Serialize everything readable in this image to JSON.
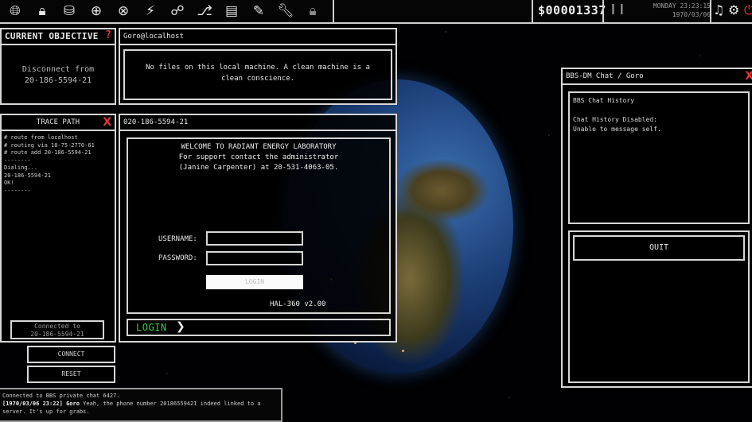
{
  "topbar": {
    "icons": [
      "globe-icon",
      "lock-globe-icon",
      "database-icon",
      "network-globe-icon",
      "linked-globe-icon",
      "satellite-icon",
      "broken-link-icon",
      "stamp-icon",
      "notebook-icon",
      "notepad-icon",
      "wrench-icon",
      "padlock-icon"
    ],
    "money": "$00001337",
    "pause_glyph": "❙❙",
    "clock_line1": "MONDAY 23:23:15",
    "clock_line2": "1970/03/06",
    "music_glyph": "♫",
    "gear_glyph": "⚙",
    "power_glyph": "⏻"
  },
  "objective": {
    "title": "CURRENT OBJECTIVE",
    "help": "?",
    "line1": "Disconnect from",
    "line2": "20-186-5594-21"
  },
  "local": {
    "title": "Goro@localhost",
    "message": "No files on this local machine. A clean machine is a clean conscience."
  },
  "trace": {
    "title": "TRACE PATH",
    "close": "X",
    "lines": "# route from localhost\n# routing via 18-75-2770-61\n# route add 20-186-5594-21\n--------\nDialing...\n20-186-5594-21\nOK!\n--------",
    "connected_line1": "Connected to",
    "connected_line2": "20-186-5594-21"
  },
  "actions": {
    "connect": "CONNECT",
    "reset": "RESET"
  },
  "remote": {
    "title": "020-186-5594-21",
    "welcome1": "WELCOME TO RADIANT ENERGY LABORATORY",
    "welcome2": "For support contact the administrator",
    "welcome3": "(Janine Carpenter) at 20-531-4063-05.",
    "username_label": "USERNAME:",
    "password_label": "PASSWORD:",
    "login_button": "LOGIN",
    "version": "HAL-360 v2.00",
    "login_bar": "LOGIN",
    "login_arrow": "❯"
  },
  "chat": {
    "title": "BBS-DM Chat / Goro",
    "close": "X",
    "history_lines": "BBS Chat History\n\nChat History Disabled:\nUnable to message self.",
    "quit": "QUIT"
  },
  "log": {
    "line1": "Connected to BBS private chat 6427.",
    "line2_prefix": "[1970/03/06 23:22] Goro",
    "line2_text": " Yeah, the phone number 20186559421 indeed linked to a",
    "line3": "server. It's up for grabs."
  }
}
